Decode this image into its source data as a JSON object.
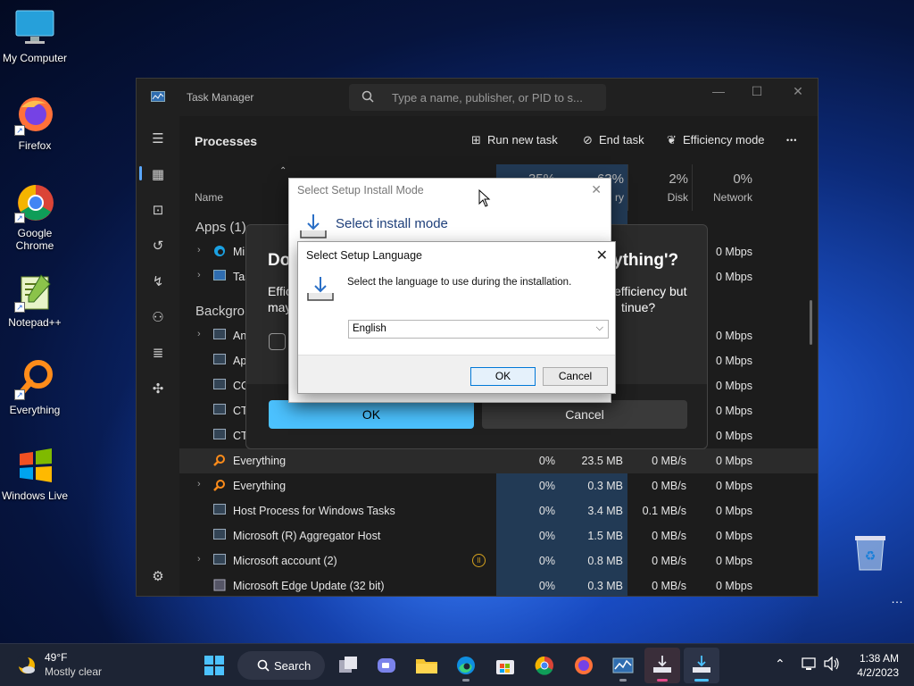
{
  "desktop": {
    "icons": [
      {
        "label": "My Computer",
        "icon": "monitor-icon"
      },
      {
        "label": "Firefox",
        "icon": "firefox-icon"
      },
      {
        "label": "Google Chrome",
        "icon": "chrome-icon"
      },
      {
        "label": "Notepad++",
        "icon": "notepadpp-icon"
      },
      {
        "label": "Everything",
        "icon": "everything-icon"
      },
      {
        "label": "Windows Live",
        "icon": "windows-live-icon"
      }
    ],
    "recycle_bin_icon": "recycle-bin-icon",
    "more_indicator": "…"
  },
  "task_manager": {
    "title": "Task Manager",
    "search_placeholder": "Type a name, publisher, or PID to s...",
    "heading": "Processes",
    "toolbar": {
      "run_new_task": "Run new task",
      "end_task": "End task",
      "efficiency_mode": "Efficiency mode",
      "more": "•••"
    },
    "columns": {
      "name": "Name",
      "cpu_pct": "35%",
      "memory_pct": "63%",
      "memory_label": "ry",
      "disk_pct": "2%",
      "disk_label": "Disk",
      "network_pct": "0%",
      "network_label": "Network"
    },
    "groups": {
      "apps": "Apps (1)",
      "background": "Backgro"
    },
    "app_rows": [
      {
        "name": "Mi",
        "network": "0 Mbps"
      },
      {
        "name": "Tas",
        "network": "0 Mbps"
      }
    ],
    "background_rows": [
      {
        "name": "An",
        "network": "0 Mbps"
      },
      {
        "name": "Ap",
        "network": "0 Mbps"
      },
      {
        "name": "CO",
        "network": "0 Mbps"
      },
      {
        "name": "CT",
        "network": "0 Mbps"
      },
      {
        "name": "CT",
        "network": "0 Mbps"
      }
    ],
    "rows": [
      {
        "name": "Everything",
        "cpu": "0%",
        "memory": "23.5 MB",
        "disk": "0 MB/s",
        "network": "0 Mbps",
        "expandable": false,
        "selected": true
      },
      {
        "name": "Everything",
        "cpu": "0%",
        "memory": "0.3 MB",
        "disk": "0 MB/s",
        "network": "0 Mbps",
        "expandable": true,
        "selected": false
      },
      {
        "name": "Host Process for Windows Tasks",
        "cpu": "0%",
        "memory": "3.4 MB",
        "disk": "0.1 MB/s",
        "network": "0 Mbps",
        "expandable": false,
        "selected": false
      },
      {
        "name": "Microsoft (R) Aggregator Host",
        "cpu": "0%",
        "memory": "1.5 MB",
        "disk": "0 MB/s",
        "network": "0 Mbps",
        "expandable": false,
        "selected": false
      },
      {
        "name": "Microsoft account (2)",
        "cpu": "0%",
        "memory": "0.8 MB",
        "disk": "0 MB/s",
        "network": "0 Mbps",
        "expandable": true,
        "selected": false
      },
      {
        "name": "Microsoft Edge Update (32 bit)",
        "cpu": "0%",
        "memory": "0.3 MB",
        "disk": "0 MB/s",
        "network": "0 Mbps",
        "expandable": false,
        "selected": false
      }
    ]
  },
  "efficiency_dialog": {
    "title_left": "Do",
    "title_right": "ything'?",
    "body_left_1": "Effic",
    "body_left_2": "may",
    "body_right_1": "efficiency but",
    "body_right_2": "tinue?",
    "ok": "OK",
    "cancel": "Cancel"
  },
  "install_mode_dialog": {
    "title": "Select Setup Install Mode",
    "heading": "Select install mode"
  },
  "language_dialog": {
    "title": "Select Setup Language",
    "message": "Select the language to use during the installation.",
    "selected_language": "English",
    "ok": "OK",
    "cancel": "Cancel"
  },
  "taskbar": {
    "weather_temp": "49°F",
    "weather_desc": "Mostly clear",
    "search_label": "Search",
    "time": "1:38 AM",
    "date": "4/2/2023"
  },
  "colors": {
    "accent": "#4cc2ff",
    "tm_bg": "#1c1c1c",
    "stat_shade": "#223a55"
  }
}
